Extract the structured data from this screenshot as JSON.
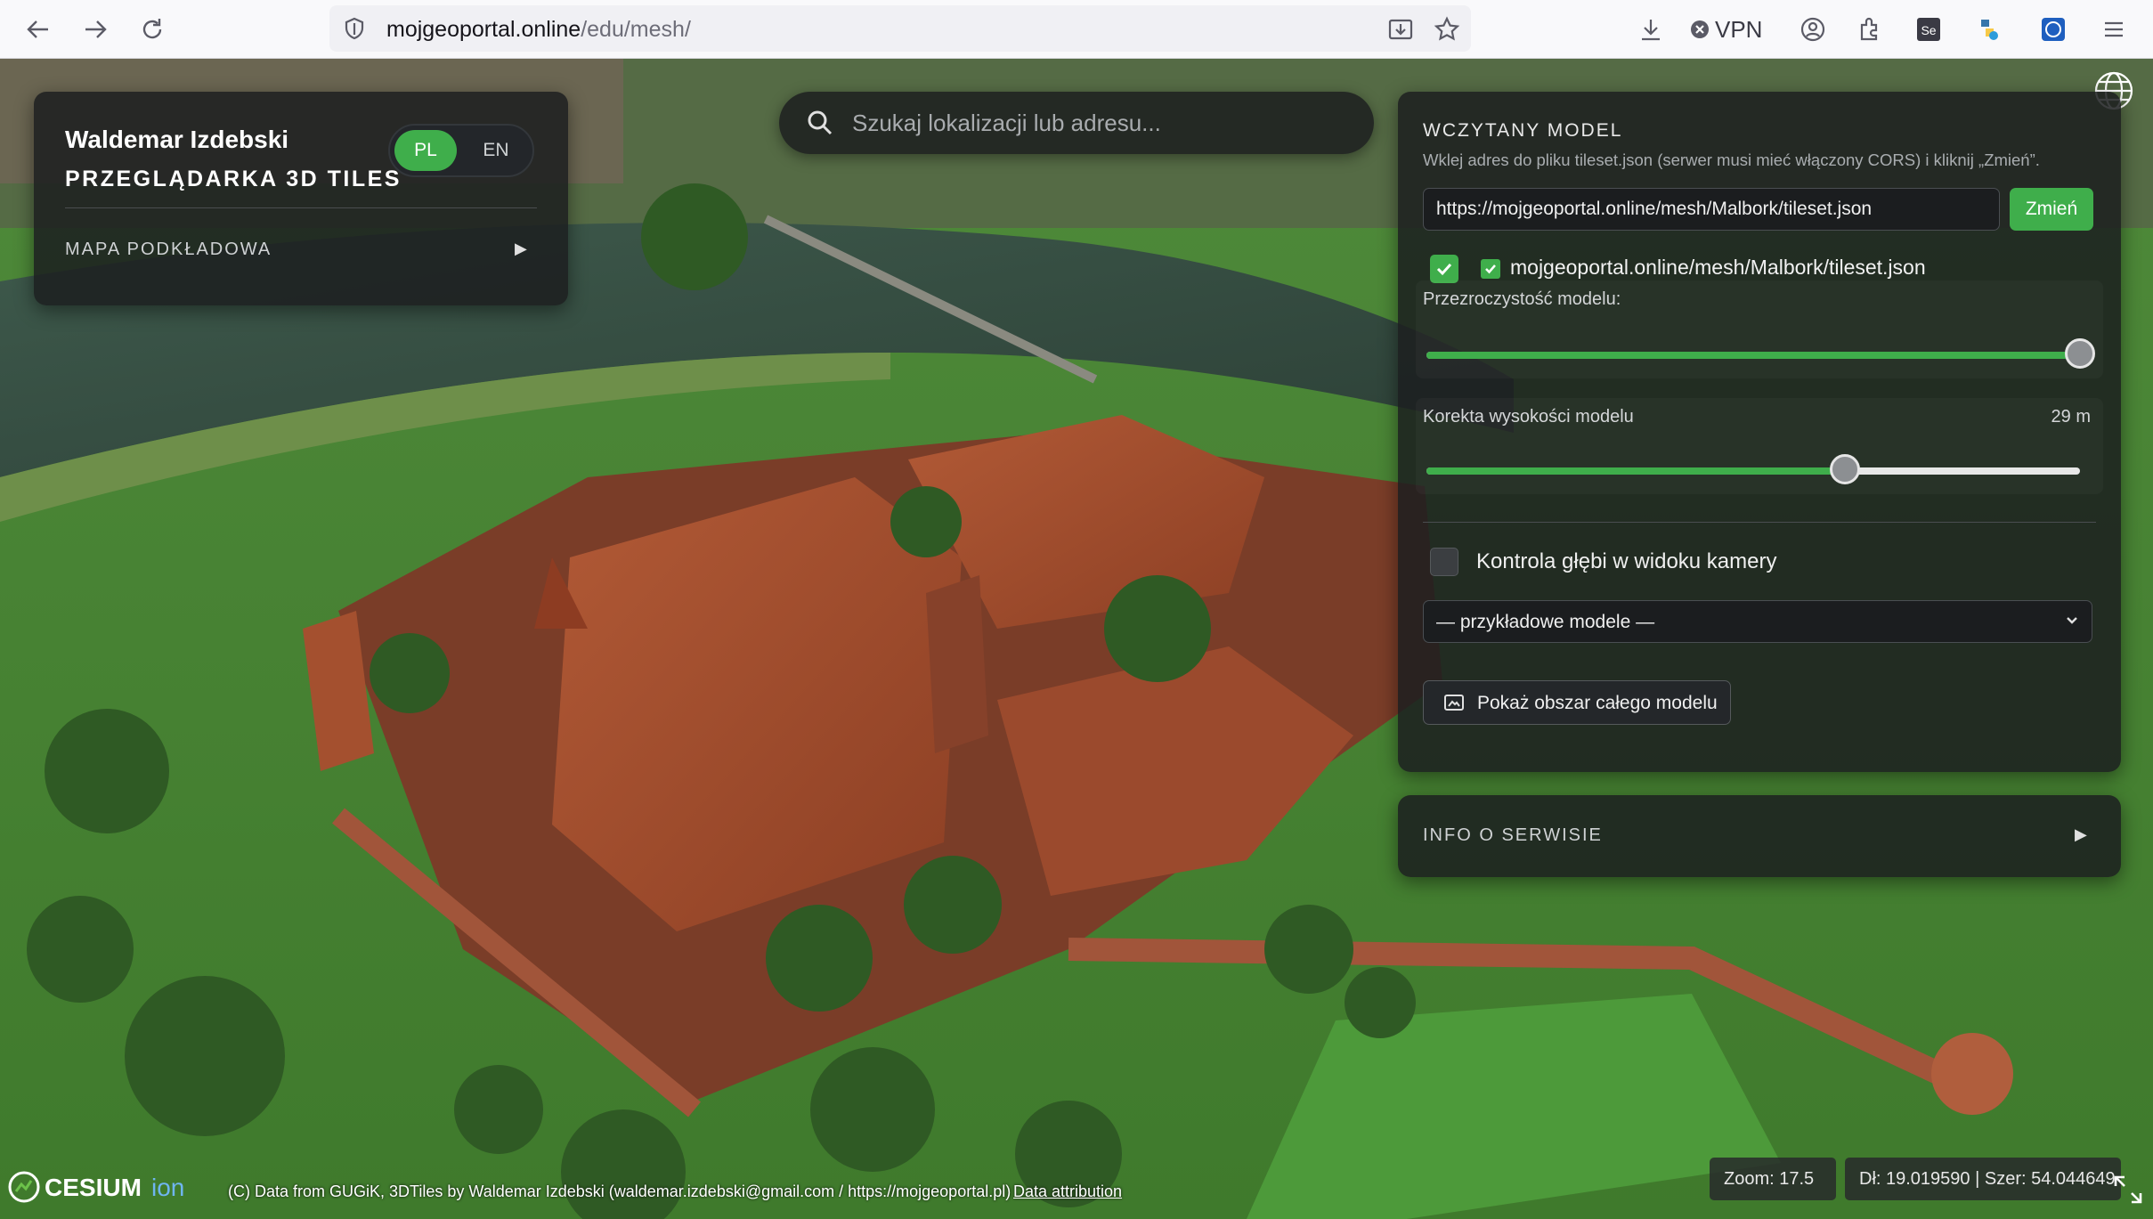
{
  "browser": {
    "url_host": "mojgeoportal.online",
    "url_path": "/edu/mesh/",
    "vpn_label": "VPN"
  },
  "header": {
    "owner_name": "Waldemar Izdebski",
    "app_title": "PRZEGLĄDARKA 3D TILES",
    "lang_pl": "PL",
    "lang_en": "EN",
    "basemap_label": "MAPA PODKŁADOWA",
    "basemap_arrow": "▶"
  },
  "search": {
    "placeholder": "Szukaj lokalizacji lub adresu..."
  },
  "model_panel": {
    "heading": "WCZYTANY MODEL",
    "help_text": "Wklej adres do pliku tileset.json (serwer musi mieć włączony CORS) i kliknij „Zmień”.",
    "url_value": "https://mojgeoportal.online/mesh/Malbork/tileset.json",
    "change_button": "Zmień",
    "layer_name": "mojgeoportal.online/mesh/Malbork/tileset.json",
    "opacity_label": "Przezroczystość modelu:",
    "opacity_value": 1.0,
    "height_label": "Korekta wysokości modelu",
    "height_value_text": "29 m",
    "height_slider_fraction": 0.64,
    "depth_label": "Kontrola głębi w widoku kamery",
    "sample_select": "— przykładowe modele —",
    "zoom_extent_button": "Pokaż obszar całego modelu"
  },
  "info_panel": {
    "label": "INFO O SERWISIE",
    "arrow": "▶"
  },
  "footer": {
    "credit_text": "(C) Data from GUGiK, 3DTiles by Waldemar Izdebski (waldemar.izdebski@gmail.com / https://mojgeoportal.pl)",
    "data_attribution": "Data attribution",
    "zoom": "Zoom: 17.5",
    "coords": "Dł: 19.019590 | Szer: 54.044649"
  },
  "colors": {
    "accent": "#3fae4b",
    "panel_bg": "#1c1e20"
  }
}
